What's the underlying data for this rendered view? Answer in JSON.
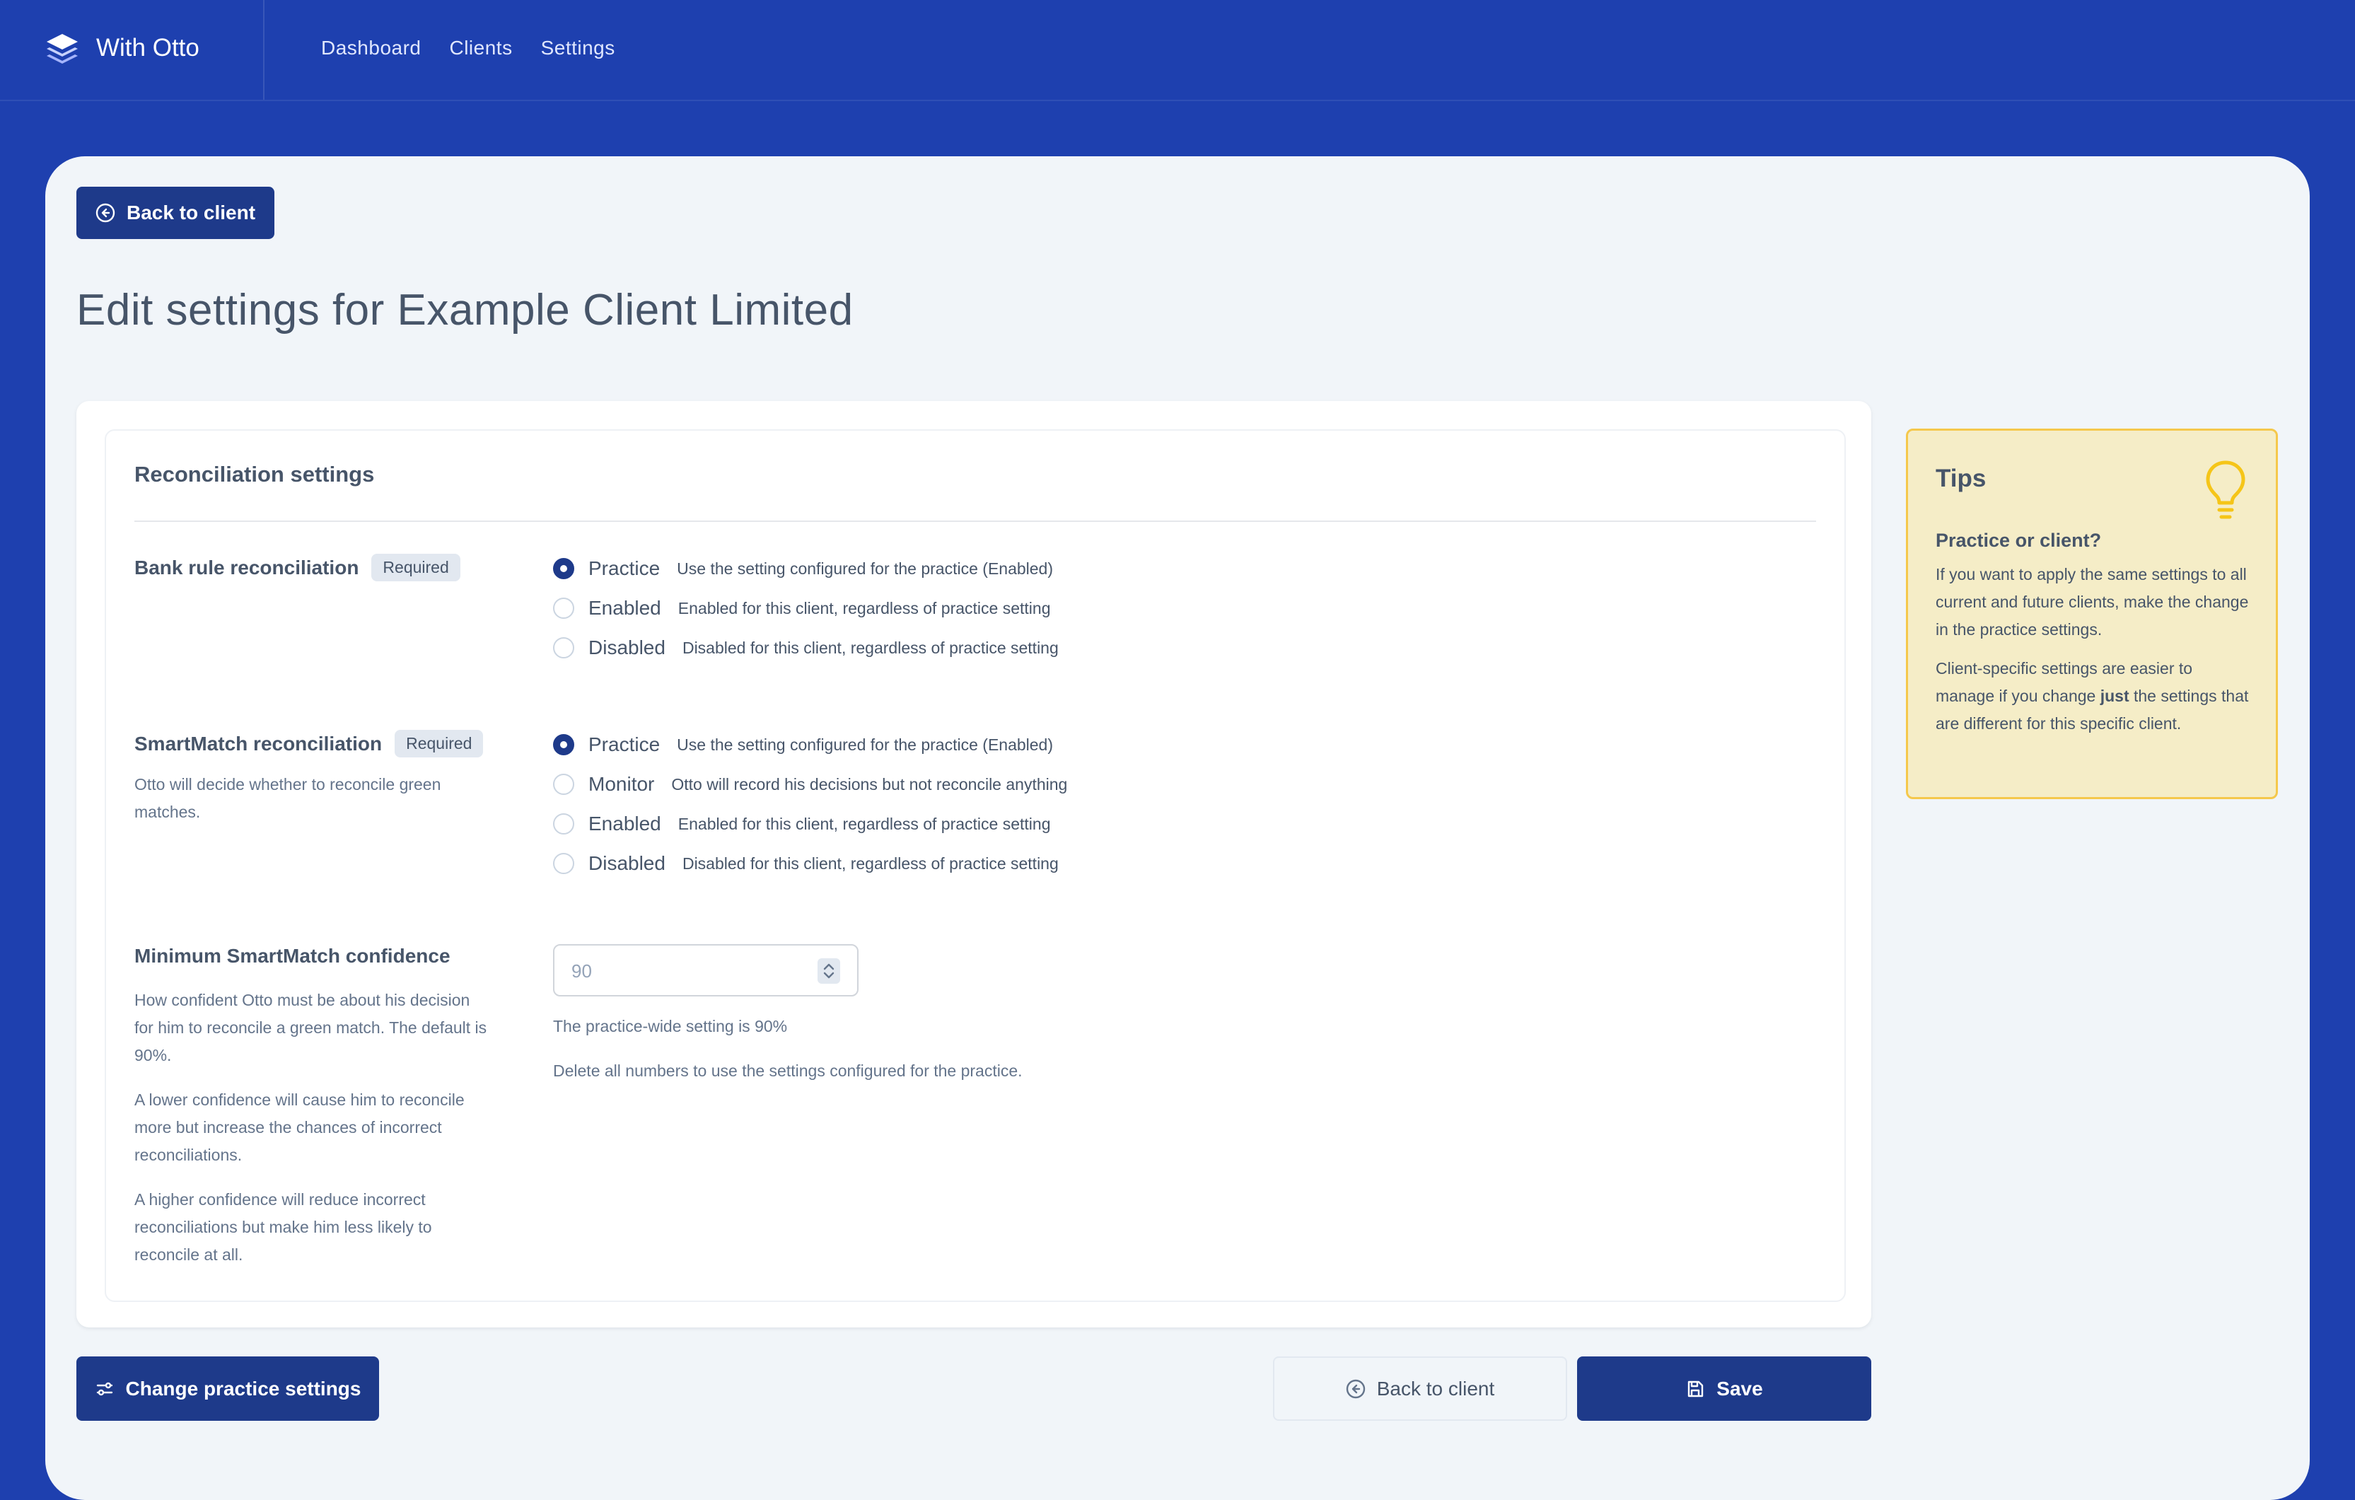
{
  "app": {
    "name": "With Otto"
  },
  "nav": [
    "Dashboard",
    "Clients",
    "Settings"
  ],
  "back_button_label": "Back to client",
  "page_title": "Edit settings for Example Client Limited",
  "section_title": "Reconciliation settings",
  "settings": {
    "bank_rule": {
      "label": "Bank rule reconciliation",
      "badge": "Required",
      "options": [
        {
          "label": "Practice",
          "help": "Use the setting configured for the practice (Enabled)",
          "selected": true
        },
        {
          "label": "Enabled",
          "help": "Enabled for this client, regardless of practice setting",
          "selected": false
        },
        {
          "label": "Disabled",
          "help": "Disabled for this client, regardless of practice setting",
          "selected": false
        }
      ]
    },
    "smartmatch": {
      "label": "SmartMatch reconciliation",
      "badge": "Required",
      "description": "Otto will decide whether to reconcile green matches.",
      "options": [
        {
          "label": "Practice",
          "help": "Use the setting configured for the practice (Enabled)",
          "selected": true
        },
        {
          "label": "Monitor",
          "help": "Otto will record his decisions but not reconcile anything",
          "selected": false
        },
        {
          "label": "Enabled",
          "help": "Enabled for this client, regardless of practice setting",
          "selected": false
        },
        {
          "label": "Disabled",
          "help": "Disabled for this client, regardless of practice setting",
          "selected": false
        }
      ]
    },
    "confidence": {
      "label": "Minimum SmartMatch confidence",
      "paragraphs": [
        "How confident Otto must be about his decision for him to reconcile a green match. The default is 90%.",
        "A lower confidence will cause him to reconcile more but increase the chances of incorrect reconciliations.",
        "A higher confidence will reduce incorrect reconciliations but make him less likely to reconcile at all."
      ],
      "input_placeholder": "90",
      "practice_hint": "The practice-wide setting is 90%",
      "delete_hint": "Delete all numbers to use the settings configured for the practice."
    }
  },
  "tips": {
    "title": "Tips",
    "subtitle": "Practice or client?",
    "para1": "If you want to apply the same settings to all current and future clients, make the change in the practice settings.",
    "para2_before": "Client-specific settings are easier to manage if you change ",
    "para2_bold": "just",
    "para2_after": " the settings that are different for this specific client."
  },
  "footer": {
    "change_practice_label": "Change practice settings",
    "back_label": "Back to client",
    "save_label": "Save"
  },
  "icons": {
    "logo": "stack-layers-icon",
    "back": "arrow-left-circle-icon",
    "sliders": "sliders-icon",
    "save": "floppy-disk-icon",
    "tips": "lightbulb-icon"
  },
  "colors": {
    "nav_bg": "#1e40af",
    "primary": "#1e3a8a",
    "page_bg": "#f1f5f9",
    "tips_bg": "#f5edc7",
    "tips_border": "#f5c84c"
  }
}
